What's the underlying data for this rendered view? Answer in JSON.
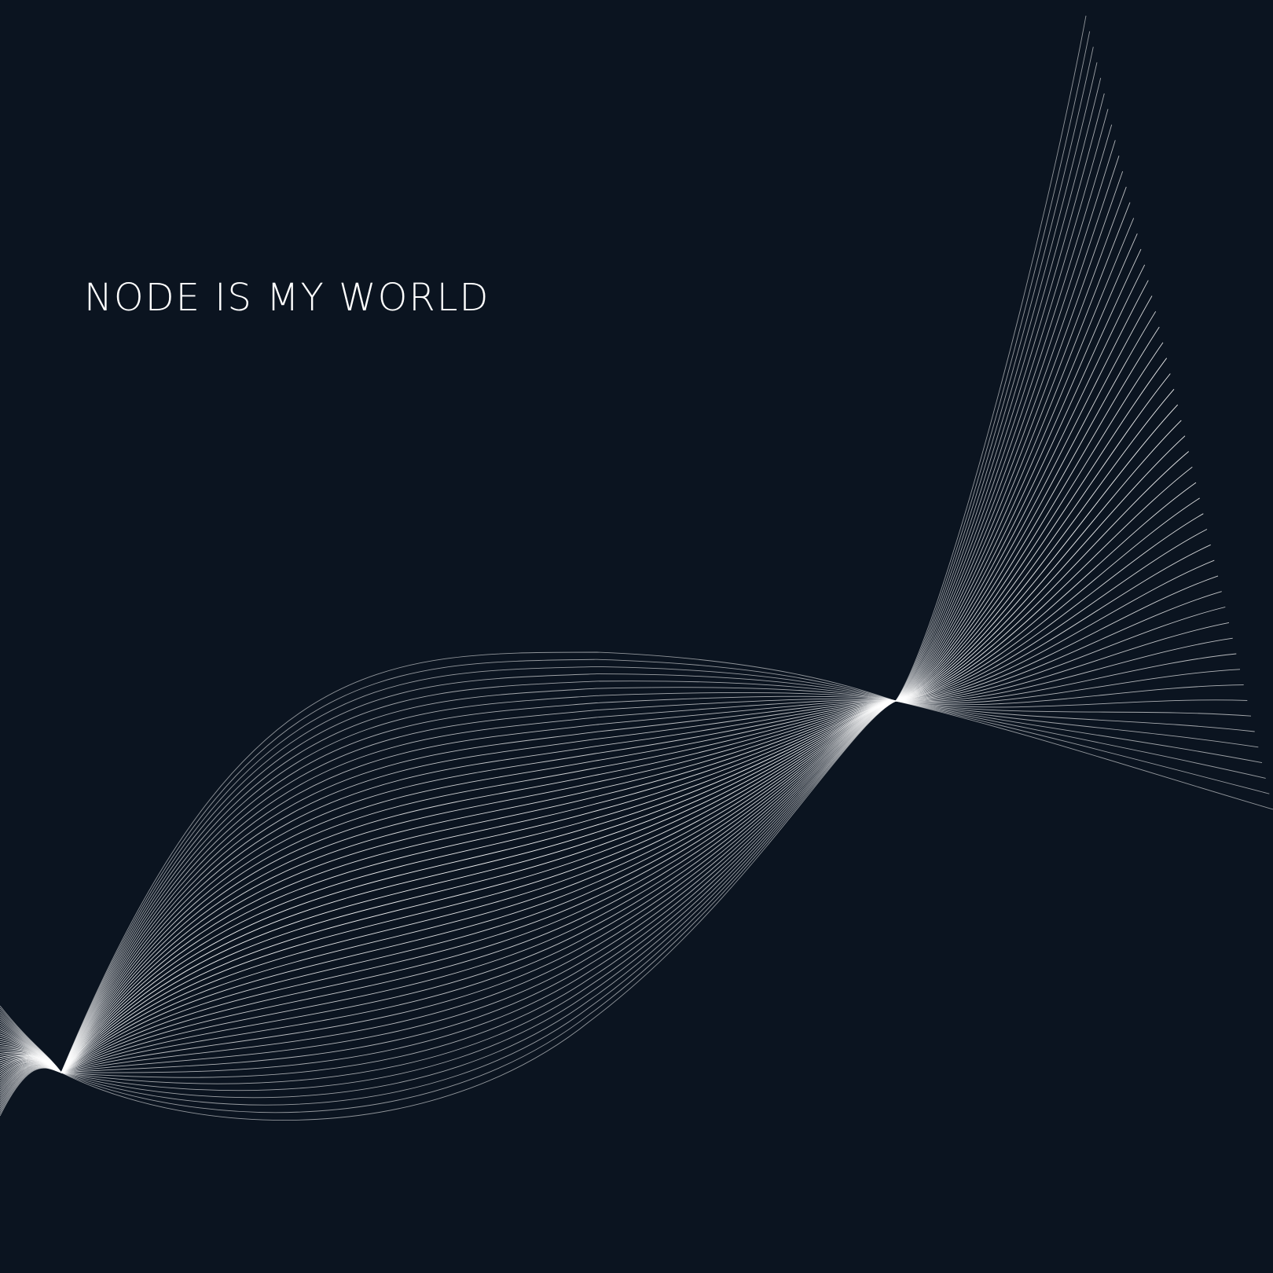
{
  "headline": "NODE IS MY WORLD",
  "colors": {
    "background": "#0b1420",
    "text": "#ffffff",
    "lines": "#ffffff"
  },
  "artwork": "line-wave"
}
